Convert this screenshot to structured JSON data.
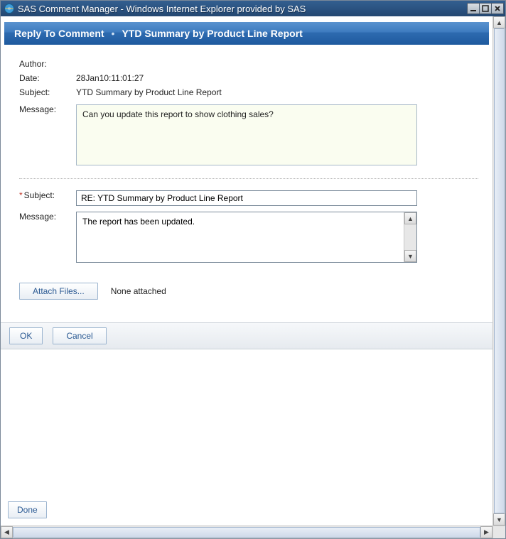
{
  "window": {
    "title": "SAS Comment Manager - Windows Internet Explorer provided by SAS"
  },
  "header": {
    "crumb1": "Reply To Comment",
    "crumb2": "YTD Summary by Product Line Report"
  },
  "labels": {
    "author": "Author:",
    "date": "Date:",
    "subject": "Subject:",
    "message": "Message:",
    "subject2": "Subject:",
    "message2": "Message:"
  },
  "original": {
    "author": "",
    "date": "28Jan10:11:01:27",
    "subject": "YTD Summary by Product Line Report",
    "message": "Can you update this report to show clothing sales?"
  },
  "reply": {
    "subject": "RE: YTD Summary by Product Line Report",
    "message": "The report has been updated."
  },
  "buttons": {
    "attach": "Attach Files...",
    "attach_status": "None attached",
    "ok": "OK",
    "cancel": "Cancel",
    "done": "Done"
  }
}
